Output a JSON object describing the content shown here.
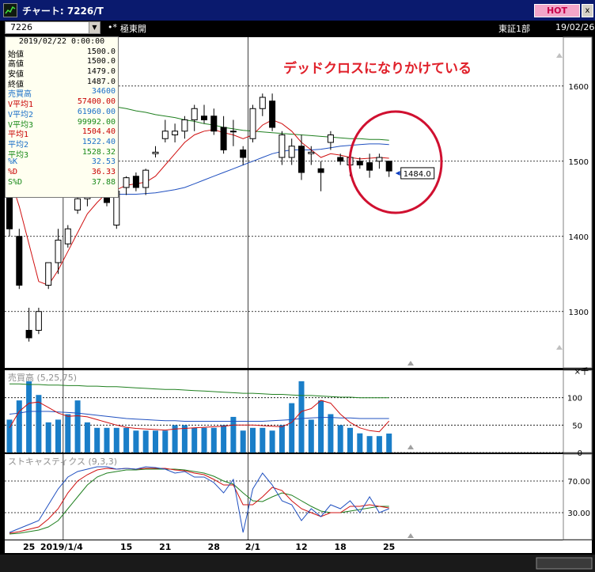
{
  "window": {
    "title": "チャート: 7226/T",
    "hot_label": "HOT",
    "close_label": "x"
  },
  "toolbar": {
    "code_value": "7226",
    "marker": "•*",
    "company": "極東開",
    "market": "東証1部",
    "date": "19/02/26"
  },
  "info_panel": {
    "date": "2019/02/22 0:00:00",
    "rows": [
      {
        "label": "始値",
        "value": "1500.0",
        "color": "#000000"
      },
      {
        "label": "高値",
        "value": "1500.0",
        "color": "#000000"
      },
      {
        "label": "安値",
        "value": "1479.0",
        "color": "#000000"
      },
      {
        "label": "終値",
        "value": "1487.0",
        "color": "#000000"
      },
      {
        "label": "売買高",
        "value": "34600",
        "color": "#1a6fc8"
      },
      {
        "label": "V平均1",
        "value": "57400.00",
        "color": "#c80000"
      },
      {
        "label": "V平均2",
        "value": "61960.00",
        "color": "#1a6fc8"
      },
      {
        "label": "V平均3",
        "value": "99992.00",
        "color": "#1a8a1a"
      },
      {
        "label": "平均1",
        "value": "1504.40",
        "color": "#c80000"
      },
      {
        "label": "平均2",
        "value": "1522.40",
        "color": "#1a6fc8"
      },
      {
        "label": "平均3",
        "value": "1528.32",
        "color": "#1a8a1a"
      },
      {
        "label": "%K",
        "value": "32.53",
        "color": "#1a6fc8"
      },
      {
        "label": "%D",
        "value": "36.33",
        "color": "#c80000"
      },
      {
        "label": "S%D",
        "value": "37.88",
        "color": "#1a8a1a"
      }
    ]
  },
  "annotation": {
    "text": "デッドクロスになりかけている",
    "color": "#e0202a"
  },
  "colors": {
    "candle_up": "#ffffff",
    "candle_down": "#000000",
    "ma1": "#d01010",
    "ma2": "#2050c0",
    "ma3": "#208020",
    "volume_bar": "#1a7ec8",
    "circle": "#d01030"
  },
  "chart_data": {
    "price_panel": {
      "type": "candlestick",
      "x": [
        "2018-12-20",
        "2018-12-21",
        "2018-12-25",
        "2018-12-26",
        "2018-12-27",
        "2018-12-28",
        "2019-01-04",
        "2019-01-07",
        "2019-01-08",
        "2019-01-09",
        "2019-01-10",
        "2019-01-11",
        "2019-01-15",
        "2019-01-16",
        "2019-01-17",
        "2019-01-18",
        "2019-01-21",
        "2019-01-22",
        "2019-01-23",
        "2019-01-24",
        "2019-01-25",
        "2019-01-28",
        "2019-01-29",
        "2019-01-30",
        "2019-01-31",
        "2019-02-01",
        "2019-02-04",
        "2019-02-05",
        "2019-02-06",
        "2019-02-07",
        "2019-02-08",
        "2019-02-12",
        "2019-02-13",
        "2019-02-14",
        "2019-02-15",
        "2019-02-18",
        "2019-02-19",
        "2019-02-20",
        "2019-02-21",
        "2019-02-22"
      ],
      "ohlc": [
        [
          1500,
          1520,
          1400,
          1410
        ],
        [
          1400,
          1410,
          1330,
          1335
        ],
        [
          1275,
          1305,
          1260,
          1265
        ],
        [
          1275,
          1305,
          1270,
          1300
        ],
        [
          1335,
          1360,
          1330,
          1365
        ],
        [
          1365,
          1410,
          1350,
          1395
        ],
        [
          1390,
          1415,
          1385,
          1410
        ],
        [
          1435,
          1460,
          1430,
          1450
        ],
        [
          1450,
          1455,
          1440,
          1452
        ],
        [
          1460,
          1470,
          1455,
          1465
        ],
        [
          1460,
          1470,
          1440,
          1445
        ],
        [
          1415,
          1465,
          1410,
          1460
        ],
        [
          1465,
          1480,
          1455,
          1478
        ],
        [
          1480,
          1485,
          1460,
          1465
        ],
        [
          1465,
          1490,
          1455,
          1488
        ],
        [
          1510,
          1520,
          1505,
          1512
        ],
        [
          1530,
          1555,
          1525,
          1540
        ],
        [
          1535,
          1550,
          1525,
          1540
        ],
        [
          1540,
          1560,
          1530,
          1555
        ],
        [
          1555,
          1575,
          1540,
          1570
        ],
        [
          1560,
          1575,
          1550,
          1555
        ],
        [
          1560,
          1570,
          1535,
          1540
        ],
        [
          1545,
          1560,
          1510,
          1515
        ],
        [
          1540,
          1555,
          1520,
          1540
        ],
        [
          1515,
          1520,
          1495,
          1505
        ],
        [
          1530,
          1575,
          1525,
          1570
        ],
        [
          1570,
          1590,
          1560,
          1585
        ],
        [
          1580,
          1590,
          1540,
          1545
        ],
        [
          1505,
          1540,
          1495,
          1535
        ],
        [
          1505,
          1530,
          1495,
          1520
        ],
        [
          1520,
          1535,
          1475,
          1485
        ],
        [
          1510,
          1520,
          1495,
          1512
        ],
        [
          1490,
          1500,
          1460,
          1485
        ],
        [
          1525,
          1540,
          1515,
          1535
        ],
        [
          1505,
          1510,
          1495,
          1500
        ],
        [
          1495,
          1510,
          1480,
          1505
        ],
        [
          1500,
          1505,
          1490,
          1495
        ],
        [
          1498,
          1510,
          1478,
          1488
        ],
        [
          1500,
          1510,
          1490,
          1505
        ],
        [
          1500,
          1500,
          1479,
          1487
        ]
      ],
      "ma1": [
        1480,
        1440,
        1390,
        1340,
        1335,
        1355,
        1380,
        1405,
        1430,
        1445,
        1458,
        1462,
        1468,
        1470,
        1472,
        1480,
        1495,
        1510,
        1525,
        1535,
        1540,
        1542,
        1538,
        1535,
        1530,
        1535,
        1548,
        1555,
        1550,
        1540,
        1525,
        1515,
        1505,
        1510,
        1508,
        1505,
        1503,
        1504,
        1505,
        1504
      ],
      "ma2": [
        1520,
        1505,
        1490,
        1478,
        1470,
        1466,
        1462,
        1460,
        1458,
        1457,
        1456,
        1456,
        1456,
        1456,
        1457,
        1458,
        1460,
        1462,
        1465,
        1470,
        1475,
        1480,
        1485,
        1490,
        1495,
        1500,
        1505,
        1510,
        1513,
        1515,
        1515,
        1515,
        1516,
        1518,
        1520,
        1521,
        1522,
        1523,
        1523,
        1522
      ],
      "ma3": [
        1600,
        1598,
        1595,
        1592,
        1590,
        1588,
        1585,
        1582,
        1580,
        1578,
        1575,
        1572,
        1570,
        1567,
        1565,
        1562,
        1560,
        1558,
        1555,
        1553,
        1550,
        1548,
        1545,
        1543,
        1541,
        1540,
        1539,
        1538,
        1537,
        1536,
        1535,
        1534,
        1533,
        1532,
        1531,
        1530,
        1530,
        1529,
        1529,
        1528
      ],
      "last_price_label": "1484.0",
      "ylim": [
        1225,
        1665
      ],
      "y_ticks": [
        "1300",
        "1400",
        "1500",
        "1600"
      ],
      "unit_label": "×千"
    },
    "volume_panel": {
      "type": "bar",
      "title": "売買高 (5,25,75)",
      "values": [
        60,
        95,
        130,
        105,
        55,
        60,
        70,
        95,
        55,
        45,
        45,
        45,
        45,
        40,
        40,
        40,
        40,
        50,
        50,
        45,
        45,
        45,
        50,
        65,
        40,
        45,
        45,
        40,
        50,
        90,
        130,
        60,
        95,
        70,
        50,
        45,
        35,
        30,
        30,
        34.6
      ],
      "v_ma1": [
        45,
        75,
        90,
        92,
        82,
        72,
        66,
        67,
        65,
        60,
        55,
        50,
        46,
        44,
        43,
        42,
        41,
        43,
        44,
        45,
        46,
        47,
        48,
        50,
        50,
        50,
        49,
        48,
        47,
        55,
        75,
        80,
        95,
        90,
        70,
        55,
        45,
        40,
        38,
        57.4
      ],
      "v_ma2": [
        70,
        72,
        75,
        75,
        75,
        74,
        73,
        72,
        70,
        68,
        66,
        64,
        62,
        61,
        60,
        59,
        58,
        58,
        57,
        57,
        57,
        57,
        57,
        57,
        57,
        57,
        57,
        58,
        59,
        60,
        62,
        63,
        64,
        64,
        63,
        63,
        62,
        62,
        62,
        62
      ],
      "v_ma3": [
        125,
        125,
        124,
        124,
        123,
        123,
        122,
        122,
        121,
        121,
        120,
        120,
        119,
        118,
        117,
        116,
        115,
        115,
        114,
        113,
        112,
        111,
        110,
        109,
        108,
        108,
        107,
        106,
        106,
        105,
        104,
        104,
        103,
        102,
        101,
        101,
        100,
        100,
        100,
        100
      ],
      "ylim": [
        0,
        150
      ],
      "y_ticks": [
        "0",
        "50",
        "100"
      ]
    },
    "stochastic_panel": {
      "type": "line",
      "title": "ストキャスティクス (9,3,3)",
      "k": [
        5,
        10,
        15,
        20,
        40,
        60,
        75,
        82,
        85,
        88,
        88,
        85,
        86,
        85,
        88,
        87,
        85,
        80,
        82,
        75,
        75,
        68,
        55,
        72,
        5,
        60,
        80,
        65,
        45,
        40,
        20,
        35,
        25,
        40,
        35,
        45,
        30,
        50,
        30,
        35
      ],
      "d": [
        4,
        6,
        9,
        12,
        22,
        35,
        55,
        70,
        78,
        84,
        86,
        85,
        86,
        85,
        86,
        86,
        86,
        84,
        83,
        80,
        78,
        72,
        65,
        65,
        40,
        40,
        50,
        62,
        58,
        45,
        35,
        30,
        25,
        30,
        30,
        38,
        38,
        40,
        38,
        36
      ],
      "sd": [
        3,
        4,
        6,
        8,
        12,
        20,
        35,
        50,
        65,
        75,
        80,
        82,
        84,
        84,
        85,
        85,
        85,
        85,
        84,
        82,
        80,
        76,
        70,
        66,
        55,
        45,
        44,
        50,
        55,
        52,
        45,
        38,
        32,
        30,
        30,
        32,
        34,
        36,
        38,
        38
      ],
      "ylim": [
        0,
        100
      ],
      "y_ticks": [
        "30.00",
        "70.00"
      ]
    },
    "x_axis": {
      "labels": [
        {
          "text": "25",
          "index": 2
        },
        {
          "text": "2019/1/4",
          "index": 6
        },
        {
          "text": "15",
          "index": 12
        },
        {
          "text": "21",
          "index": 16
        },
        {
          "text": "28",
          "index": 21
        },
        {
          "text": "2/1",
          "index": 25
        },
        {
          "text": "12",
          "index": 30
        },
        {
          "text": "18",
          "index": 34
        },
        {
          "text": "25",
          "index": 39
        }
      ]
    }
  }
}
